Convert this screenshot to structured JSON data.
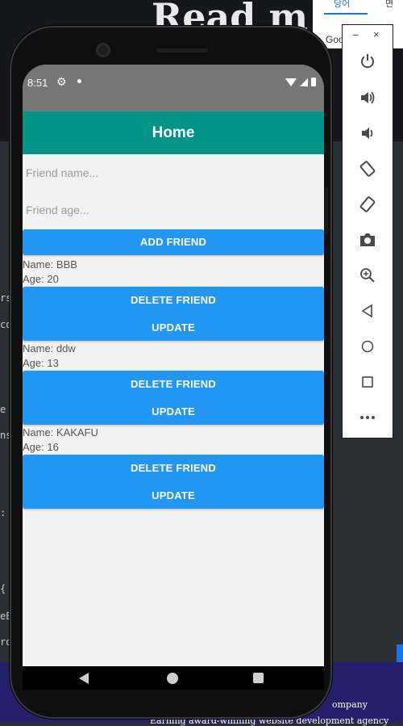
{
  "background": {
    "site_title": "Read m",
    "browser_tabs": [
      "당어",
      "면"
    ],
    "browser_sub": "Goo  e",
    "bottom_text_1": "ompany",
    "bottom_text_2": "Earning award-winning website development agency"
  },
  "status_bar": {
    "time": "8:51"
  },
  "app_bar": {
    "title": "Home"
  },
  "form": {
    "name_placeholder": "Friend name...",
    "age_placeholder": "Friend age...",
    "add_label": "ADD FRIEND"
  },
  "friends": [
    {
      "name": "Name: BBB",
      "age": "Age: 20",
      "delete_label": "DELETE FRIEND",
      "update_label": "UPDATE"
    },
    {
      "name": "Name: ddw",
      "age": "Age: 13",
      "delete_label": "DELETE FRIEND",
      "update_label": "UPDATE"
    },
    {
      "name": "Name: KAKAFU",
      "age": "Age: 16",
      "delete_label": "DELETE FRIEND",
      "update_label": "UPDATE"
    }
  ],
  "emulator_panel": {
    "minimize": "−",
    "close": "×",
    "buttons": [
      "power-icon",
      "volume-up-icon",
      "volume-down-icon",
      "rotate-left-icon",
      "rotate-right-icon",
      "screenshot-icon",
      "zoom-icon",
      "back-icon",
      "home-icon",
      "overview-icon",
      "more-icon"
    ]
  },
  "colors": {
    "app_bar": "#009387",
    "button": "#2196f3",
    "status_bar": "#767676",
    "screen_bg": "#f2f2f2"
  }
}
